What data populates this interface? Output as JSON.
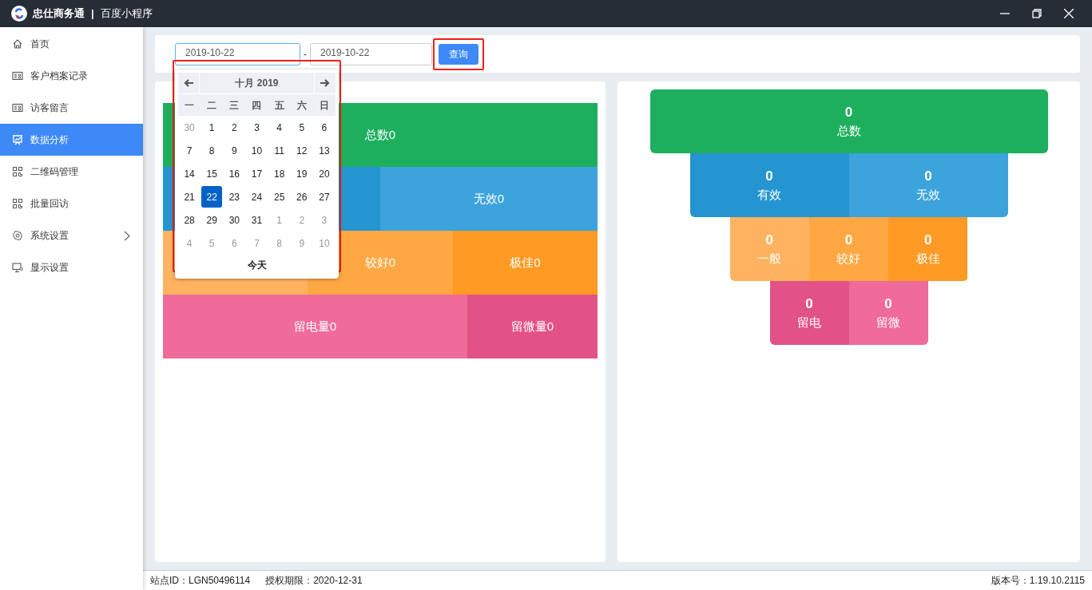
{
  "window": {
    "app_name": "忠仕商务通",
    "separator": "|",
    "subtitle": "百度小程序"
  },
  "sidebar": {
    "items": [
      {
        "label": "首页",
        "selected": false,
        "expandable": false
      },
      {
        "label": "客户档案记录",
        "selected": false,
        "expandable": false
      },
      {
        "label": "访客留言",
        "selected": false,
        "expandable": false
      },
      {
        "label": "数据分析",
        "selected": true,
        "expandable": false
      },
      {
        "label": "二维码管理",
        "selected": false,
        "expandable": false
      },
      {
        "label": "批量回访",
        "selected": false,
        "expandable": false
      },
      {
        "label": "系统设置",
        "selected": false,
        "expandable": true
      },
      {
        "label": "显示设置",
        "selected": false,
        "expandable": false
      }
    ]
  },
  "filter": {
    "start_date": "2019-10-22",
    "dash": "-",
    "end_date": "2019-10-22",
    "query_button": "查询"
  },
  "calendar": {
    "title": "十月 2019",
    "weekdays": [
      "一",
      "二",
      "三",
      "四",
      "五",
      "六",
      "日"
    ],
    "weeks": [
      [
        {
          "day": "30",
          "muted": true,
          "selected": false
        },
        {
          "day": "1",
          "muted": false,
          "selected": false
        },
        {
          "day": "2",
          "muted": false,
          "selected": false
        },
        {
          "day": "3",
          "muted": false,
          "selected": false
        },
        {
          "day": "4",
          "muted": false,
          "selected": false
        },
        {
          "day": "5",
          "muted": false,
          "selected": false
        },
        {
          "day": "6",
          "muted": false,
          "selected": false
        }
      ],
      [
        {
          "day": "7",
          "muted": false,
          "selected": false
        },
        {
          "day": "8",
          "muted": false,
          "selected": false
        },
        {
          "day": "9",
          "muted": false,
          "selected": false
        },
        {
          "day": "10",
          "muted": false,
          "selected": false
        },
        {
          "day": "11",
          "muted": false,
          "selected": false
        },
        {
          "day": "12",
          "muted": false,
          "selected": false
        },
        {
          "day": "13",
          "muted": false,
          "selected": false
        }
      ],
      [
        {
          "day": "14",
          "muted": false,
          "selected": false
        },
        {
          "day": "15",
          "muted": false,
          "selected": false
        },
        {
          "day": "16",
          "muted": false,
          "selected": false
        },
        {
          "day": "17",
          "muted": false,
          "selected": false
        },
        {
          "day": "18",
          "muted": false,
          "selected": false
        },
        {
          "day": "19",
          "muted": false,
          "selected": false
        },
        {
          "day": "20",
          "muted": false,
          "selected": false
        }
      ],
      [
        {
          "day": "21",
          "muted": false,
          "selected": false
        },
        {
          "day": "22",
          "muted": false,
          "selected": true
        },
        {
          "day": "23",
          "muted": false,
          "selected": false
        },
        {
          "day": "24",
          "muted": false,
          "selected": false
        },
        {
          "day": "25",
          "muted": false,
          "selected": false
        },
        {
          "day": "26",
          "muted": false,
          "selected": false
        },
        {
          "day": "27",
          "muted": false,
          "selected": false
        }
      ],
      [
        {
          "day": "28",
          "muted": false,
          "selected": false
        },
        {
          "day": "29",
          "muted": false,
          "selected": false
        },
        {
          "day": "30",
          "muted": false,
          "selected": false
        },
        {
          "day": "31",
          "muted": false,
          "selected": false
        },
        {
          "day": "1",
          "muted": true,
          "selected": false
        },
        {
          "day": "2",
          "muted": true,
          "selected": false
        },
        {
          "day": "3",
          "muted": true,
          "selected": false
        }
      ],
      [
        {
          "day": "4",
          "muted": true,
          "selected": false
        },
        {
          "day": "5",
          "muted": true,
          "selected": false
        },
        {
          "day": "6",
          "muted": true,
          "selected": false
        },
        {
          "day": "7",
          "muted": true,
          "selected": false
        },
        {
          "day": "8",
          "muted": true,
          "selected": false
        },
        {
          "day": "9",
          "muted": true,
          "selected": false
        },
        {
          "day": "10",
          "muted": true,
          "selected": false
        }
      ]
    ],
    "today": "今天"
  },
  "block_chart": {
    "levels": [
      {
        "segments": [
          {
            "label": "总数0",
            "color": "#1eaf5e"
          }
        ]
      },
      {
        "segments": [
          {
            "color": "#2595d2"
          },
          {
            "label": "无效0",
            "color": "#3ca3dd"
          }
        ]
      },
      {
        "segments": [
          {
            "color": "#ffb25f"
          },
          {
            "label": "较好0",
            "color": "#ffa843"
          },
          {
            "label": "极佳0",
            "color": "#ff9a24"
          }
        ]
      },
      {
        "segments": [
          {
            "label": "留电量0",
            "color": "#ee6b9a"
          },
          {
            "label": "留微量0",
            "color": "#e25287"
          }
        ]
      }
    ]
  },
  "funnel": {
    "levels": [
      {
        "segments": [
          {
            "value": "0",
            "label": "总数",
            "color": "#1eaf5e"
          }
        ]
      },
      {
        "segments": [
          {
            "value": "0",
            "label": "有效",
            "color": "#2595d2"
          },
          {
            "value": "0",
            "label": "无效",
            "color": "#3ca3dd"
          }
        ]
      },
      {
        "segments": [
          {
            "value": "0",
            "label": "一般",
            "color": "#ffb25f"
          },
          {
            "value": "0",
            "label": "较好",
            "color": "#ffa843"
          },
          {
            "value": "0",
            "label": "极佳",
            "color": "#ff9a24"
          }
        ]
      },
      {
        "segments": [
          {
            "value": "0",
            "label": "留电",
            "color": "#e25287"
          },
          {
            "value": "0",
            "label": "留微",
            "color": "#ee6b9a"
          }
        ]
      }
    ]
  },
  "status_bar": {
    "site_id": "站点ID：LGN50496114",
    "license": "授权期限：2020-12-31",
    "version": "版本号：1.19.10.2115"
  }
}
